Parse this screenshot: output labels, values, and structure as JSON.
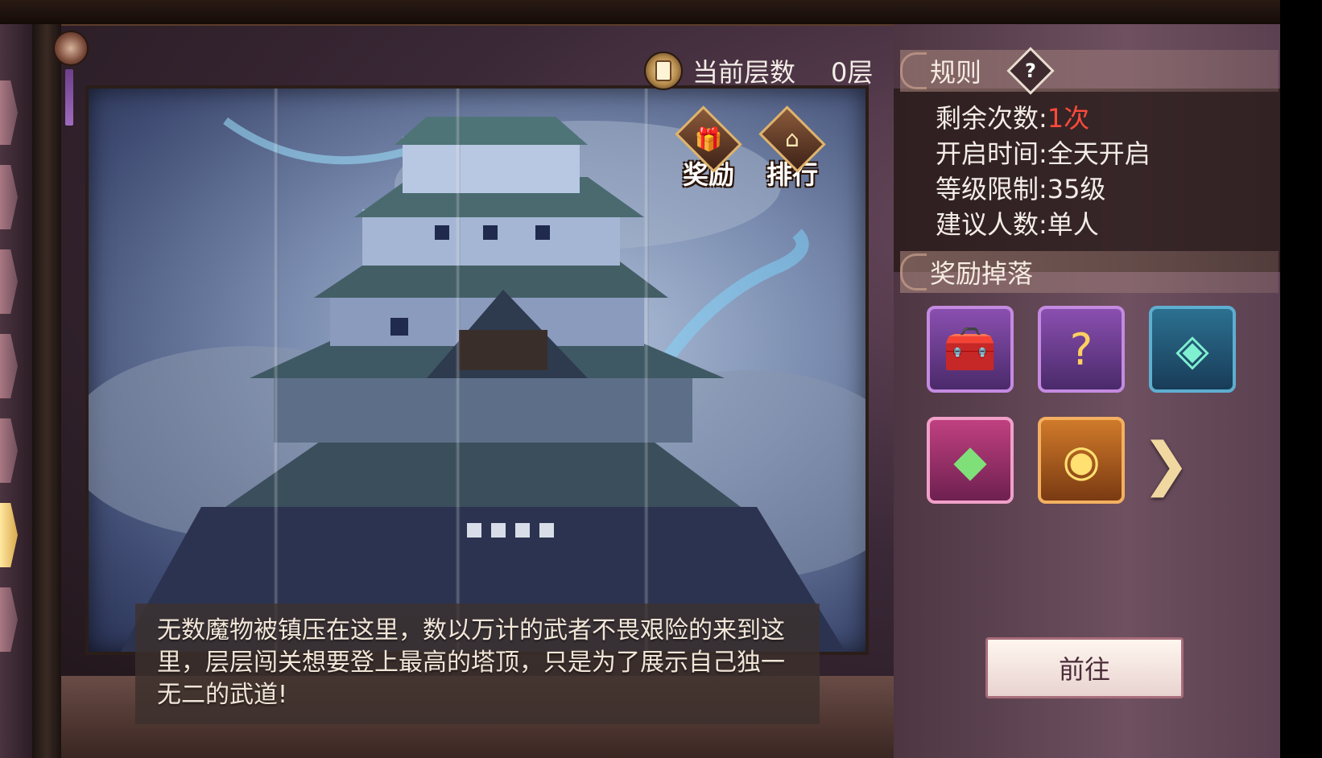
{
  "floor": {
    "label": "当前层数",
    "value": "0层"
  },
  "top_buttons": {
    "reward_label": "奖励",
    "rank_label": "排行"
  },
  "description": "无数魔物被镇压在这里，数以万计的武者不畏艰险的来到这里，层层闯关想要登上最高的塔顶，只是为了展示自己独一无二的武道!",
  "rules": {
    "title": "规则",
    "help_glyph": "?",
    "remaining_label": "剩余次数:",
    "remaining_value": "1次",
    "open_time": "开启时间:全天开启",
    "level_limit": "等级限制:35级",
    "players": "建议人数:单人"
  },
  "drops": {
    "title": "奖励掉落",
    "items": [
      {
        "icon": "treasure-chest-icon",
        "glyph": "🧰",
        "frame": "purple"
      },
      {
        "icon": "mystery-orb-icon",
        "glyph": "?",
        "frame": "purple"
      },
      {
        "icon": "jade-talisman-icon",
        "glyph": "◈",
        "frame": "blue"
      },
      {
        "icon": "green-crystal-icon",
        "glyph": "◆",
        "frame": "pink"
      },
      {
        "icon": "gold-coin-icon",
        "glyph": "◉",
        "frame": "orange"
      }
    ],
    "next_glyph": "❯"
  },
  "go_button_label": "前往",
  "colors": {
    "accent_red": "#ff4a3a",
    "panel": "#6e5060",
    "sky": "#7b8db0"
  }
}
